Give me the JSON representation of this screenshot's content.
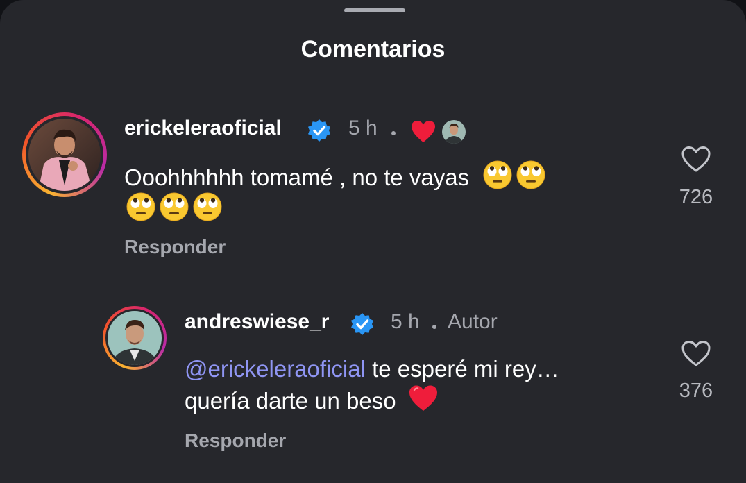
{
  "sheet": {
    "title": "Comentarios"
  },
  "comments": [
    {
      "username": "erickeleraoficial",
      "verified": true,
      "time": "5 h",
      "creator_liked": true,
      "text_line1": "Ooohhhhhh tomamé , no te vayas",
      "text_line1_emojis": 2,
      "text_line2_emojis": 3,
      "emoji": "face-with-rolling-eyes",
      "reply_label": "Responder",
      "likes": "726"
    },
    {
      "username": "andreswiese_r",
      "verified": true,
      "time": "5 h",
      "author_label": "Autor",
      "mention": "@erickeleraoficial",
      "text_line1_rest": " te esperé mi rey…",
      "text_line2": "quería darte un beso",
      "text_line2_emoji": "red-heart",
      "reply_label": "Responder",
      "likes": "376"
    }
  ],
  "colors": {
    "background": "#26272c",
    "verified": "#2a96f5",
    "mention": "#8f95f3",
    "heart": "#ef1d3b",
    "muted_text": "#a5a7ae"
  }
}
